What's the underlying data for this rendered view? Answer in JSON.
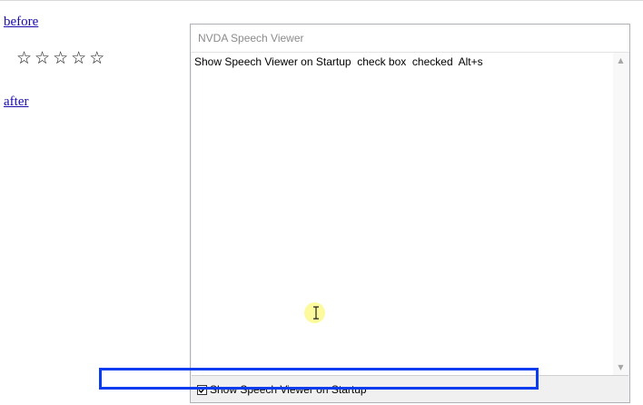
{
  "page": {
    "links": {
      "before": "before",
      "after": "after"
    },
    "rating": {
      "stars": [
        "☆",
        "☆",
        "☆",
        "☆",
        "☆"
      ]
    }
  },
  "speech_viewer": {
    "title": "NVDA Speech Viewer",
    "text": "Show Speech Viewer on Startup  check box  checked  Alt+s",
    "checkbox": {
      "label": "Show Speech Viewer on Startup",
      "checked": true
    }
  },
  "colors": {
    "link": "#1a0dab",
    "focus_highlight": "#0c3cf0",
    "mouse_highlight": "#fbf98c"
  }
}
